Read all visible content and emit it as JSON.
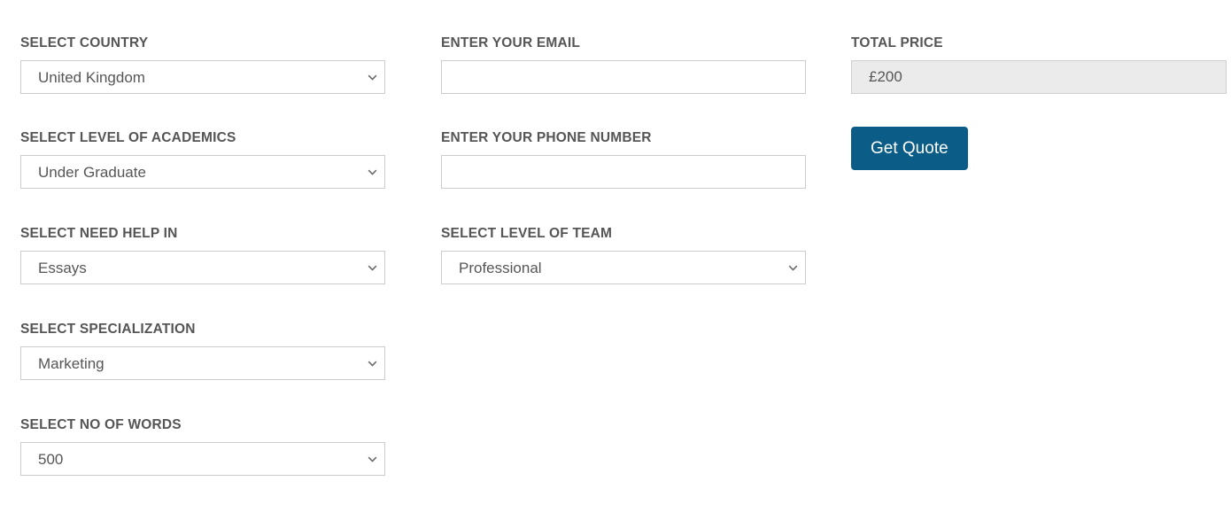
{
  "form": {
    "columns": {
      "left": {
        "fields": [
          {
            "label": "SELECT COUNTRY",
            "type": "select",
            "value": "United Kingdom",
            "icon": "chevron-down-icon",
            "name": "country"
          },
          {
            "label": "SELECT LEVEL OF ACADEMICS",
            "type": "select",
            "value": "Under Graduate",
            "icon": "chevron-down-icon",
            "name": "level-of-academics"
          },
          {
            "label": "SELECT NEED HELP IN",
            "type": "select",
            "value": "Essays",
            "icon": "chevron-down-icon",
            "name": "need-help-in"
          },
          {
            "label": "SELECT SPECIALIZATION",
            "type": "select",
            "value": "Marketing",
            "icon": "chevron-down-icon",
            "name": "specialization"
          },
          {
            "label": "SELECT NO OF WORDS",
            "type": "select",
            "value": "500",
            "icon": "chevron-down-icon",
            "name": "no-of-words"
          }
        ]
      },
      "middle": {
        "fields": [
          {
            "label": "ENTER YOUR EMAIL",
            "type": "text",
            "value": "",
            "placeholder": "",
            "name": "email"
          },
          {
            "label": "ENTER YOUR PHONE NUMBER",
            "type": "text",
            "value": "",
            "placeholder": "",
            "name": "phone-number"
          },
          {
            "label": "SELECT LEVEL OF TEAM",
            "type": "select",
            "value": "Professional",
            "icon": "chevron-down-icon",
            "name": "level-of-team"
          }
        ]
      },
      "right": {
        "price": {
          "label": "TOTAL PRICE",
          "value": "£200",
          "placeholder": "",
          "name": "total-price"
        },
        "submit": {
          "label": "Get Quote",
          "name": "get-quote"
        }
      }
    }
  },
  "theme": {
    "page_background": "#ffffff",
    "label_color": "#555555",
    "field_text_color": "#565656",
    "field_border_color": "#cccccc",
    "readonly_background": "#ebebeb",
    "readonly_border": "#cfcfcf",
    "accent_color": "#0b5c87",
    "button_text_color": "#ffffff"
  }
}
